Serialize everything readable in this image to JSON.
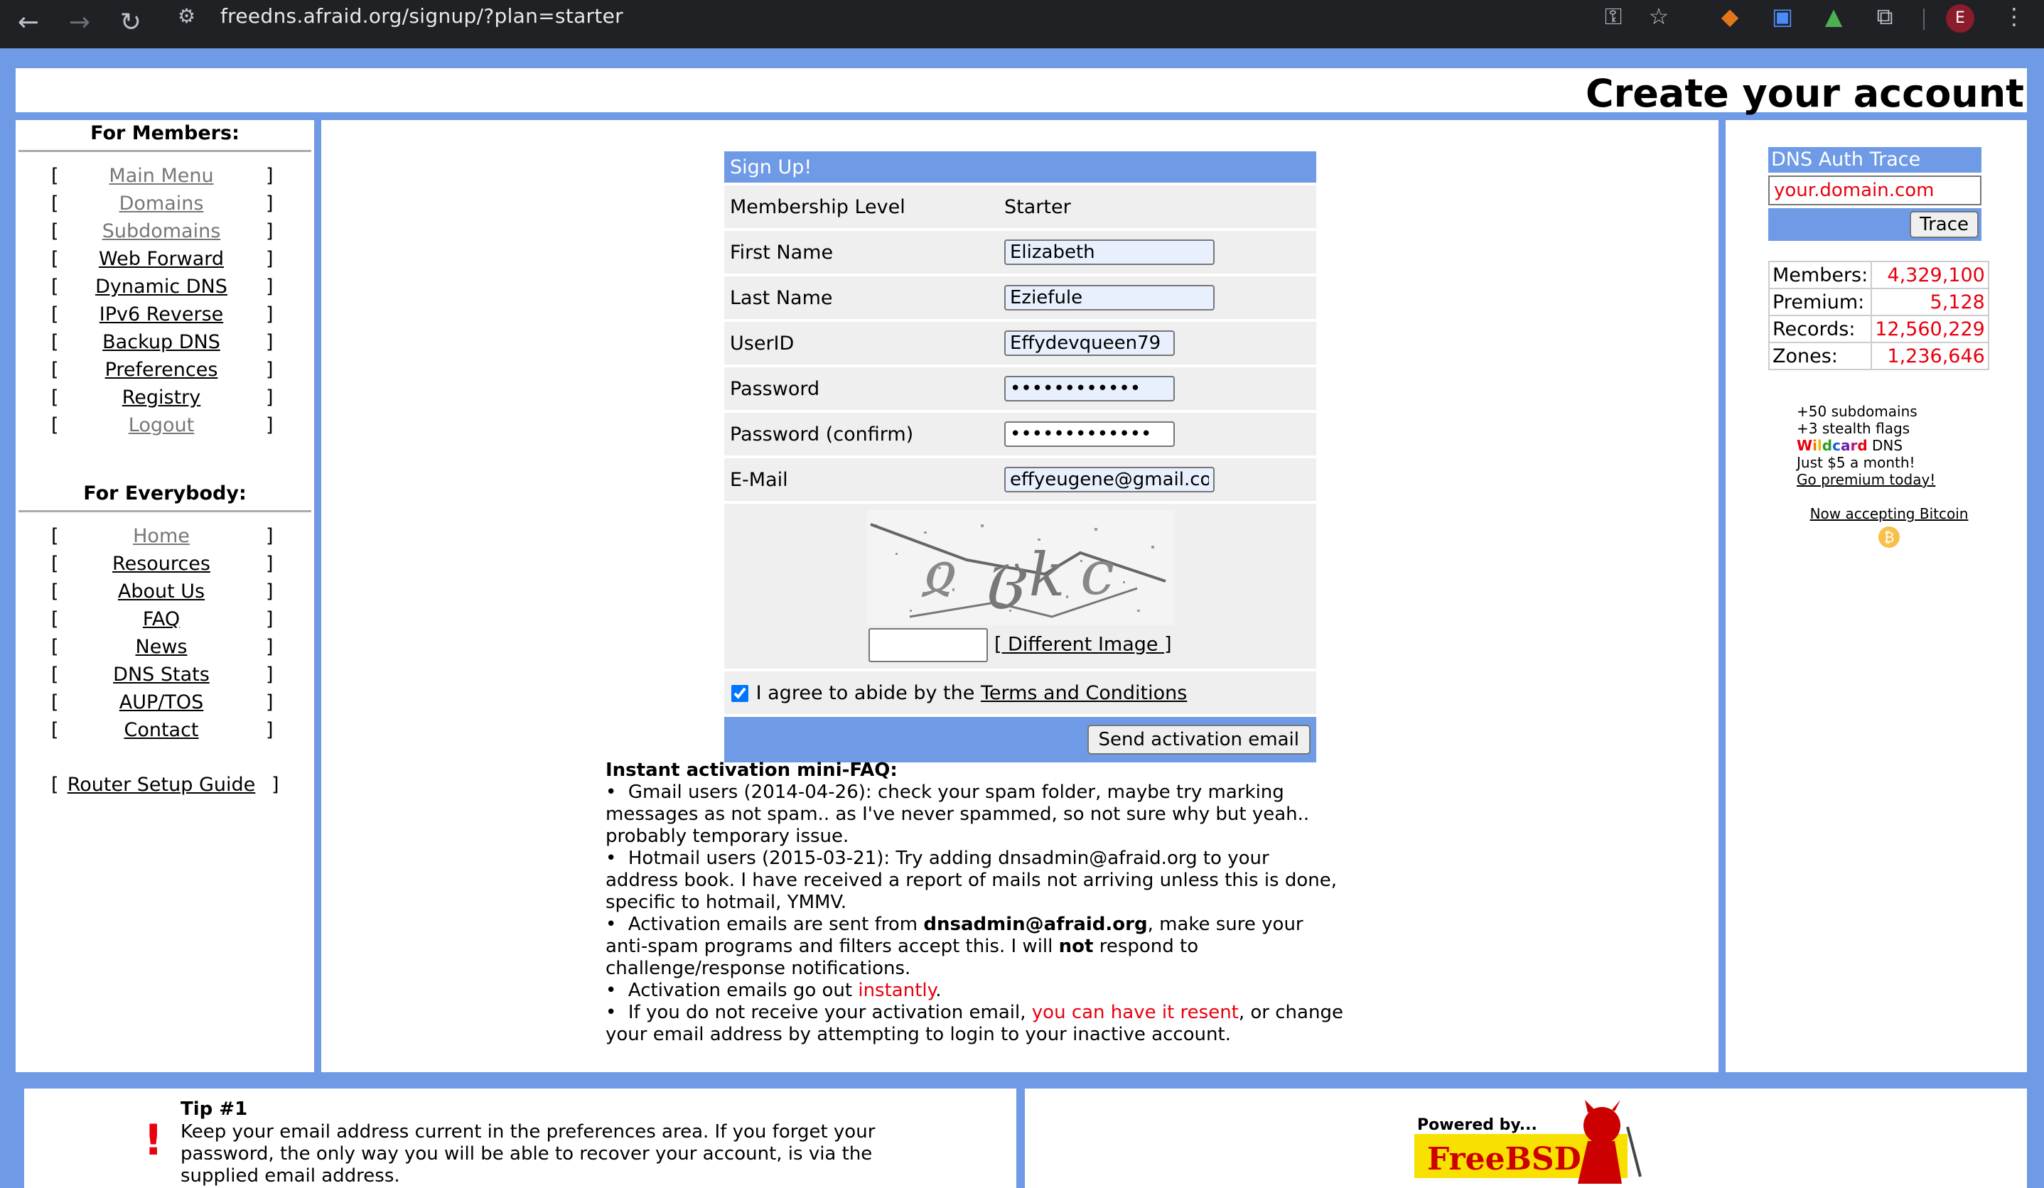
{
  "browser": {
    "url": "freedns.afraid.org/signup/?plan=starter",
    "avatar_letter": "E"
  },
  "header": {
    "title": "Create your account"
  },
  "members_menu": {
    "heading": "For Members:",
    "items": [
      {
        "label": "Main Menu",
        "dim": true
      },
      {
        "label": "Domains",
        "dim": true
      },
      {
        "label": "Subdomains",
        "dim": true
      },
      {
        "label": "Web Forward",
        "dim": false
      },
      {
        "label": "Dynamic DNS",
        "dim": false
      },
      {
        "label": "IPv6 Reverse",
        "dim": false
      },
      {
        "label": "Backup DNS",
        "dim": false
      },
      {
        "label": "Preferences",
        "dim": false
      },
      {
        "label": "Registry",
        "dim": false
      },
      {
        "label": "Logout",
        "dim": true
      }
    ]
  },
  "everybody_menu": {
    "heading": "For Everybody:",
    "items": [
      {
        "label": "Home",
        "dim": true
      },
      {
        "label": "Resources",
        "dim": false
      },
      {
        "label": "About Us",
        "dim": false
      },
      {
        "label": "FAQ",
        "dim": false
      },
      {
        "label": "News",
        "dim": false
      },
      {
        "label": "DNS Stats",
        "dim": false
      },
      {
        "label": "AUP/TOS",
        "dim": false
      },
      {
        "label": "Contact",
        "dim": false
      }
    ],
    "router_guide": "Router Setup Guide"
  },
  "signup": {
    "title": "Sign Up!",
    "membership_label": "Membership Level",
    "membership_value": "Starter",
    "first_name_label": "First Name",
    "first_name_value": "Elizabeth",
    "last_name_label": "Last Name",
    "last_name_value": "Eziefule",
    "userid_label": "UserID",
    "userid_value": "Effydevqueen79",
    "password_label": "Password",
    "password_value": "••••••••••••",
    "password_confirm_label": "Password (confirm)",
    "password_confirm_value": "•••••••••••••",
    "email_label": "E-Mail",
    "email_value": "effyeugene@gmail.com",
    "different_image_label": "[ Different Image ]",
    "agree_text": "I agree to abide by the",
    "terms_link": "Terms and Conditions",
    "submit_label": "Send activation email"
  },
  "faq": {
    "title": "Instant activation mini-FAQ:",
    "gmail": "Gmail users (2014-04-26): check your spam folder, maybe try marking messages as not spam.. as I've never spammed, so not sure why but yeah.. probably temporary issue.",
    "hotmail": "Hotmail users (2015-03-21): Try adding dnsadmin@afraid.org to your address book. I have received a report of mails not arriving unless this is done, specific to hotmail, YMMV.",
    "sent_from_a": "Activation emails are sent from",
    "sent_from_email": "dnsadmin@afraid.org",
    "sent_from_b": ", make sure your anti-spam programs and filters accept this. I will",
    "sent_from_not": "not",
    "sent_from_c": "respond to challenge/response notifications.",
    "instant_a": "Activation emails go out",
    "instant_b": "instantly",
    "instant_c": ".",
    "resend_a": "If you do not receive your activation email,",
    "resend_link": "you can have it resent",
    "resend_b": ", or change your email address by attempting to login to your inactive account."
  },
  "dns_trace": {
    "title": "DNS Auth Trace",
    "input_value": "your.domain.com",
    "button": "Trace"
  },
  "stats": [
    {
      "label": "Members:",
      "value": "4,329,100"
    },
    {
      "label": "Premium:",
      "value": "5,128"
    },
    {
      "label": "Records:",
      "value": "12,560,229"
    },
    {
      "label": "Zones:",
      "value": "1,236,646"
    }
  ],
  "promo": {
    "line1": "+50 subdomains",
    "line2": "+3 stealth flags",
    "wildcard": "Wildcard",
    "dns": "DNS",
    "line4": "Just $5 a month!",
    "link": "Go premium today!",
    "bitcoin": "Now accepting Bitcoin",
    "bitcoin_symbol": "₿"
  },
  "tip": {
    "title": "Tip #1",
    "text": "Keep your email address current in the preferences area. If you forget your password, the only way you will be able to recover your account, is via the supplied email address."
  },
  "footer": {
    "powered_by": "Powered by...",
    "freebsd": "FreeBSD"
  }
}
